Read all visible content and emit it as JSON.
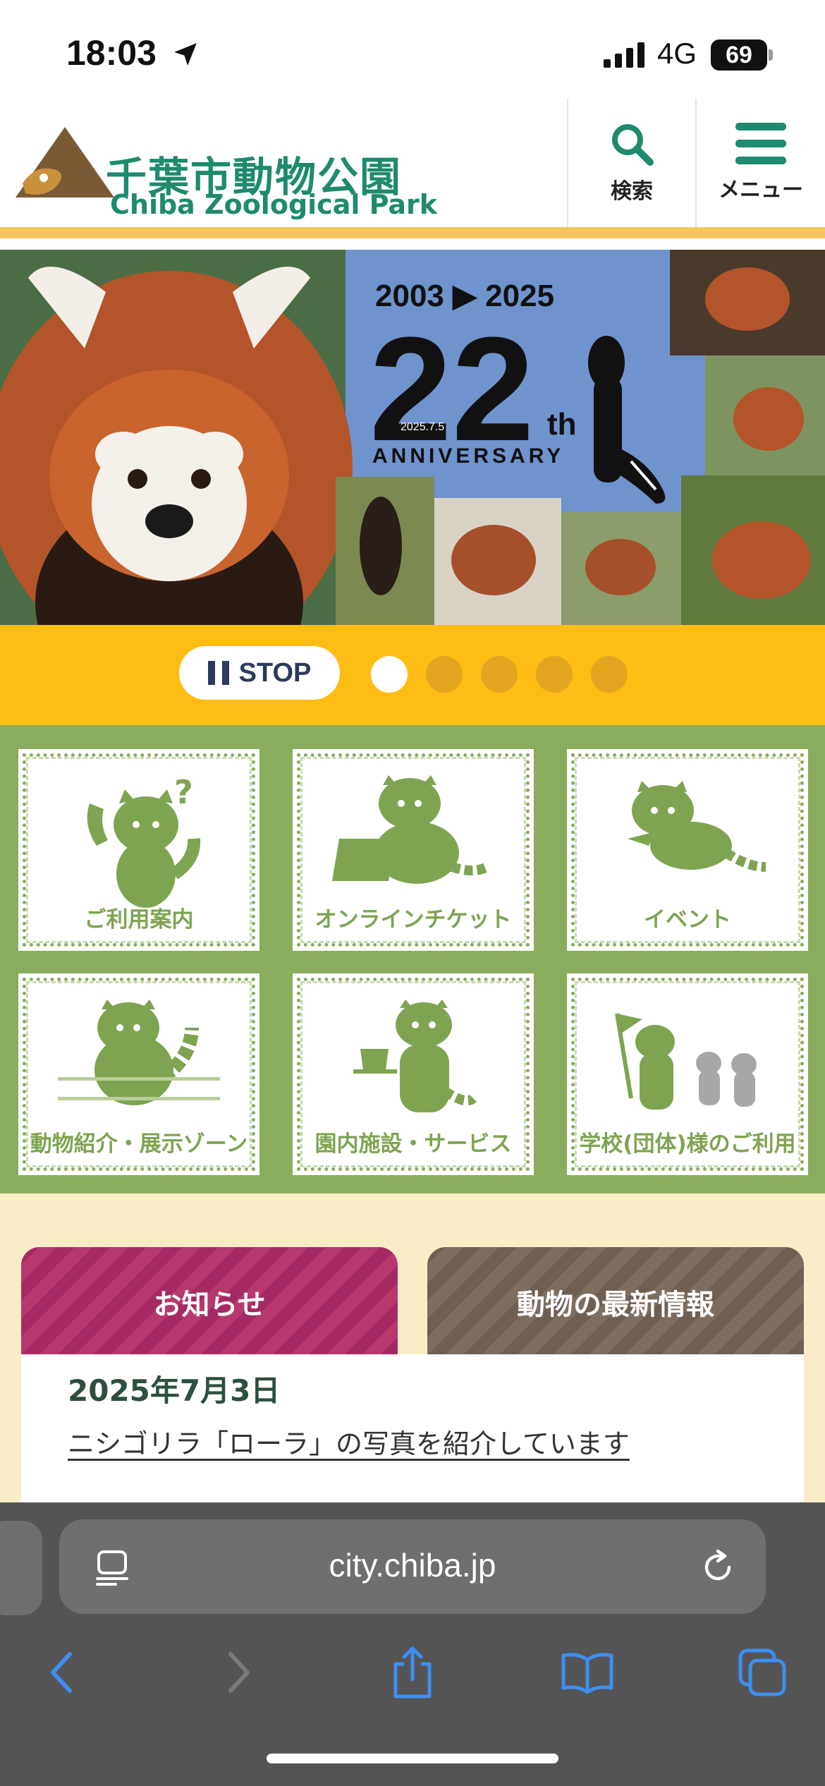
{
  "status_bar": {
    "time": "18:03",
    "network": "4G",
    "battery": "69"
  },
  "header": {
    "logo_jp": "千葉市動物公園",
    "logo_en": "Chiba Zoological Park",
    "search_label": "検索",
    "menu_label": "メニュー"
  },
  "hero": {
    "years": "2003 ▶ 2025",
    "number": "22",
    "suffix": "th",
    "date": "2025.7.5",
    "anniversary": "ANNIVERSARY"
  },
  "slider": {
    "stop_label": "STOP",
    "slide_count": 5,
    "active_slide": 1
  },
  "tiles": [
    {
      "label": "ご利用案内"
    },
    {
      "label": "オンラインチケット"
    },
    {
      "label": "イベント"
    },
    {
      "label": "動物紹介・展示ゾーン"
    },
    {
      "label": "園内施設・サービス"
    },
    {
      "label": "学校(団体)様のご利用"
    }
  ],
  "news": {
    "tab_news": "お知らせ",
    "tab_animals": "動物の最新情報",
    "items": [
      {
        "date": "2025年7月3日",
        "title": "ニシゴリラ「ローラ」の写真を紹介しています"
      }
    ]
  },
  "browser": {
    "url": "city.chiba.jp"
  },
  "colors": {
    "brand_green": "#1e8a6e",
    "slider_yellow": "#fdbd14",
    "grid_green": "#89ad5c",
    "news_tab": "#a52a63",
    "animal_tab": "#6e5f52",
    "ios_blue": "#3d8ef2"
  }
}
